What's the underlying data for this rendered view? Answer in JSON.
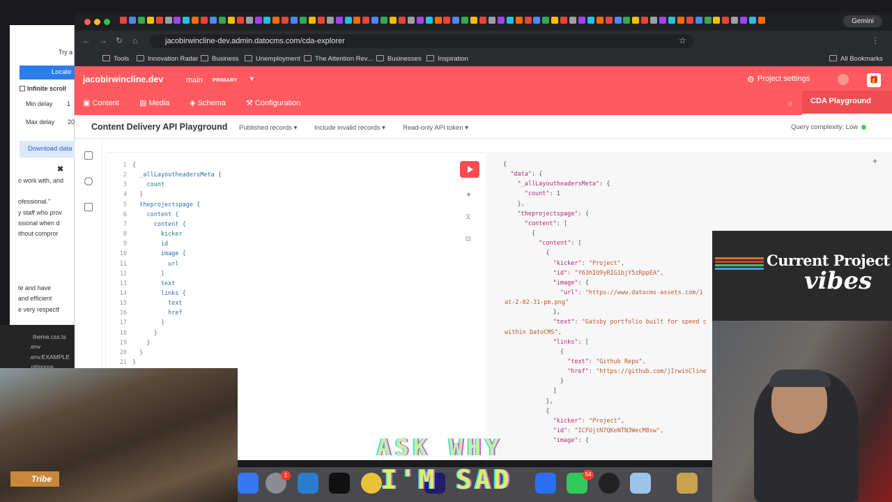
{
  "browser": {
    "url": "jacobirwincline-dev.admin.datocms.com/cda-explorer",
    "gemini_label": "Gemini",
    "all_bookmarks": "All Bookmarks",
    "bookmarks": [
      "Tools",
      "Innovation Radar",
      "Business",
      "Unemployment",
      "The Attention Rev...",
      "Businesses",
      "Inspiration"
    ]
  },
  "left_window": {
    "try_label": "Try a",
    "locate_label": "Locate",
    "infinite_scroll": "Infinite scroll",
    "min_delay": "Min delay",
    "min_delay_val": "1",
    "max_delay": "Max delay",
    "max_delay_val": "20",
    "download": "Download data",
    "lines": [
      "o work with, and",
      "ofessional.\"",
      "y staff who prov",
      "ssional when d",
      "ithout compror",
      "te and have",
      "and efficient",
      "e very respectf"
    ],
    "files": [
      "theme.css.ts",
      ".env",
      ".env.EXAMPLE",
      ".gitignore"
    ]
  },
  "dato": {
    "brand": "jacobirwincline.dev",
    "env": "main",
    "env_badge": "PRIMARY",
    "project_settings": "Project settings",
    "nav": {
      "content": "Content",
      "media": "Media",
      "schema": "Schema",
      "configuration": "Configuration",
      "cda": "CDA Playground"
    },
    "page_title": "Content Delivery API Playground",
    "filters": [
      "Published records",
      "Include invalid records",
      "Read-only API token"
    ],
    "query_complexity": "Query complexity: Low"
  },
  "editor": {
    "lines": [
      {
        "n": "1",
        "t": "{"
      },
      {
        "n": "2",
        "t": "  _allLayoutheadersMeta {"
      },
      {
        "n": "3",
        "t": "    count"
      },
      {
        "n": "4",
        "t": "  }"
      },
      {
        "n": "5",
        "t": "  theprojectspage {"
      },
      {
        "n": "6",
        "t": "    content {"
      },
      {
        "n": "7",
        "t": "      content {"
      },
      {
        "n": "8",
        "t": "        kicker"
      },
      {
        "n": "9",
        "t": "        id"
      },
      {
        "n": "10",
        "t": "        image {"
      },
      {
        "n": "11",
        "t": "          url"
      },
      {
        "n": "12",
        "t": "        }"
      },
      {
        "n": "13",
        "t": "        text"
      },
      {
        "n": "14",
        "t": "        links {"
      },
      {
        "n": "15",
        "t": "          text"
      },
      {
        "n": "16",
        "t": "          href"
      },
      {
        "n": "17",
        "t": "        }"
      },
      {
        "n": "18",
        "t": "      }"
      },
      {
        "n": "19",
        "t": "    }"
      },
      {
        "n": "20",
        "t": "  }"
      },
      {
        "n": "21",
        "t": "}"
      }
    ]
  },
  "result": {
    "lines": [
      "{",
      "  \"data\": {",
      "    \"_allLayoutheadersMeta\": {",
      "      \"count\": 1",
      "    },",
      "    \"theprojectspage\": {",
      "      \"content\": [",
      "        {",
      "          \"content\": [",
      "            {",
      "              \"kicker\": \"Project\",",
      "              \"id\": \"Y63hIO9yRIG1bjY5zRppEA\",",
      "              \"image\": {",
      "                \"url\": \"https://www.datocms-assets.com/1",
      "at-2-02-31-pm.png\"",
      "              },",
      "              \"text\": \"Gatsby portfolio built for speed c",
      "within DatoCMS\",",
      "              \"links\": [",
      "                {",
      "                  \"text\": \"Github Repo\",",
      "                  \"href\": \"https://github.com/jIrwinCline",
      "                }",
      "              ]",
      "            },",
      "            {",
      "              \"kicker\": \"Project\",",
      "              \"id\": \"ICFUjtN7QKeNTN3WecM8sw\",",
      "              \"image\": {"
    ]
  },
  "overlay": {
    "vibes_line1": "Current Project",
    "vibes_line2": "vibes",
    "ask": "ASK WHY",
    "sad": "I'M SAD",
    "tribe": "Tribe",
    "dock_badge_1": "1",
    "dock_badge_2": "54"
  },
  "colors": {
    "dato_red": "#ff5a5f",
    "run_button": "#ff4a50",
    "key_pink": "#b5296d",
    "string_orange": "#c0562b",
    "field_blue": "#2d6fb0"
  }
}
